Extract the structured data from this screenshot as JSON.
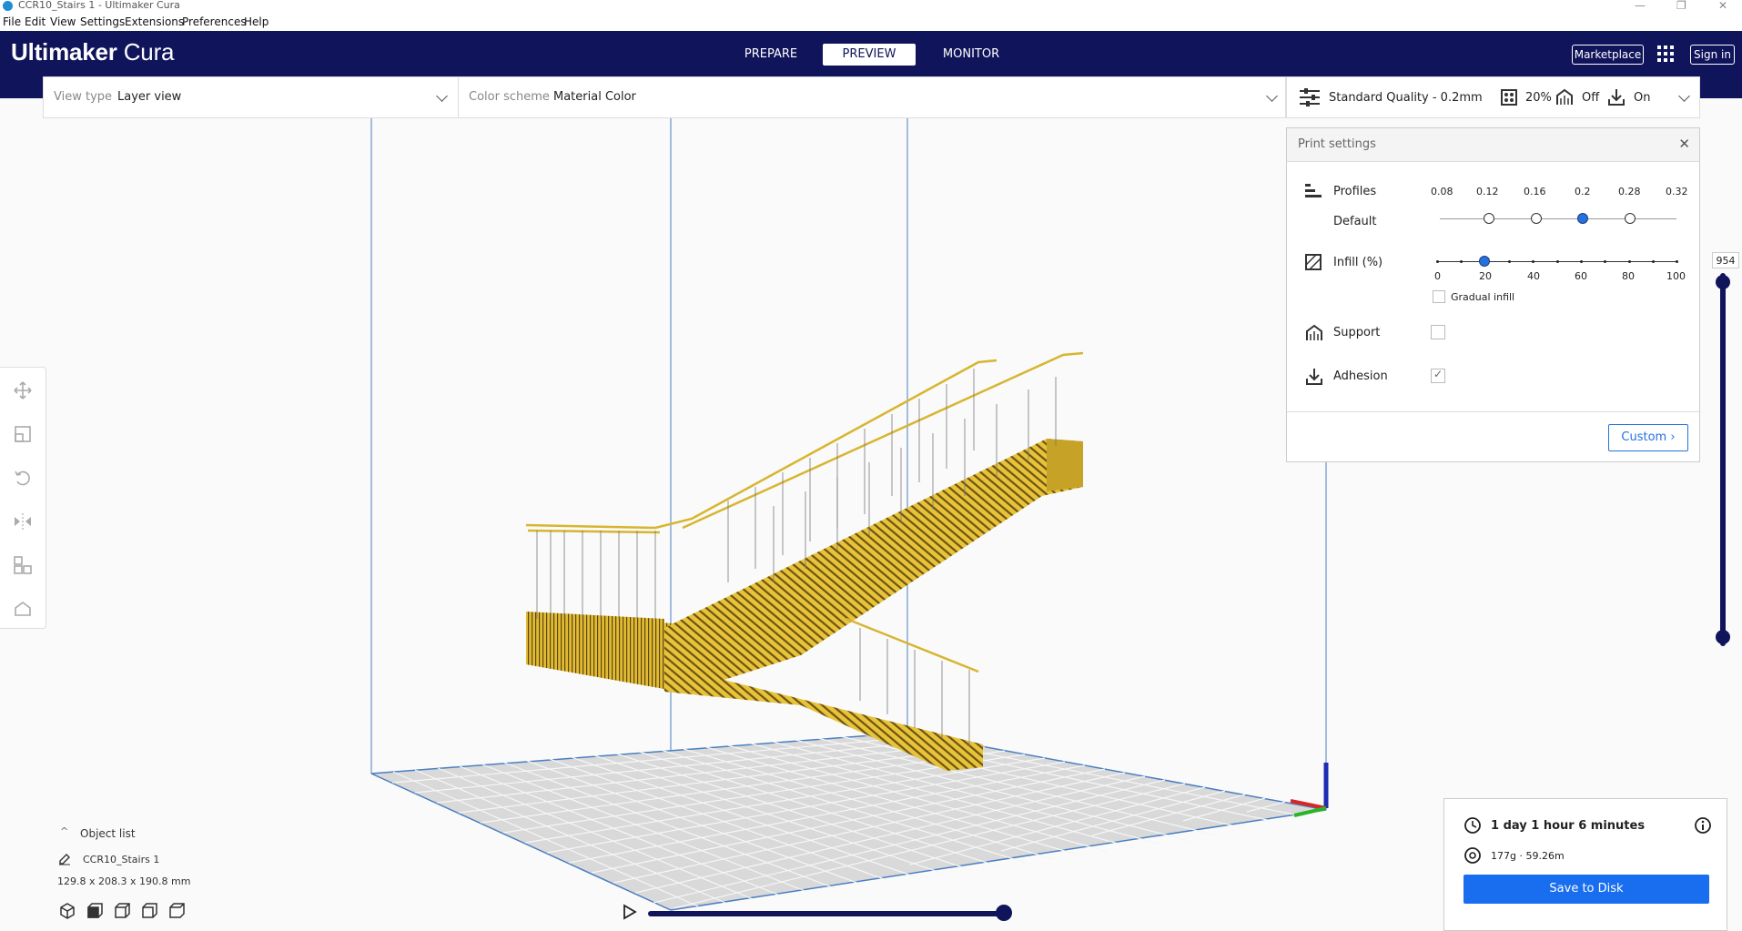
{
  "window": {
    "title": "CCR10_Stairs 1 - Ultimaker Cura",
    "minimize": "—",
    "restore": "❐",
    "close": "✕"
  },
  "menu": [
    "File",
    "Edit",
    "View",
    "Settings",
    "Extensions",
    "Preferences",
    "Help"
  ],
  "header": {
    "logo_bold": "Ultimaker",
    "logo_light": "Cura",
    "tabs": [
      {
        "label": "PREPARE",
        "active": false
      },
      {
        "label": "PREVIEW",
        "active": true
      },
      {
        "label": "MONITOR",
        "active": false
      }
    ],
    "marketplace": "Marketplace",
    "sign_in": "Sign in"
  },
  "viewbar": {
    "view_type_label": "View type",
    "view_type_value": "Layer view",
    "color_scheme_label": "Color scheme",
    "color_scheme_value": "Material Color"
  },
  "quality": {
    "profile": "Standard Quality - 0.2mm",
    "infill": "20%",
    "support": "Off",
    "adhesion": "On"
  },
  "print_settings": {
    "title": "Print settings",
    "profiles_label": "Profiles",
    "default_label": "Default",
    "profile_values": [
      "0.08",
      "0.12",
      "0.16",
      "0.2",
      "0.28",
      "0.32"
    ],
    "selected_profile": "0.2",
    "infill_label": "Infill (%)",
    "infill_ticks": [
      "0",
      "20",
      "40",
      "60",
      "80",
      "100"
    ],
    "infill_value": 20,
    "gradual_infill": "Gradual infill",
    "support_label": "Support",
    "adhesion_label": "Adhesion",
    "custom_button": "Custom"
  },
  "layer_slider": {
    "top_layer": "954"
  },
  "object_list": {
    "header": "Object list",
    "object_name": "CCR10_Stairs 1",
    "dimensions": "129.8 x 208.3 x 190.8 mm"
  },
  "estimate": {
    "time": "1 day 1 hour 6 minutes",
    "material": "177g · 59.26m",
    "save_button": "Save to Disk"
  },
  "colors": {
    "header_bg": "#10145a",
    "accent_blue": "#196ef0",
    "material_yellow": "#e8c33a"
  }
}
